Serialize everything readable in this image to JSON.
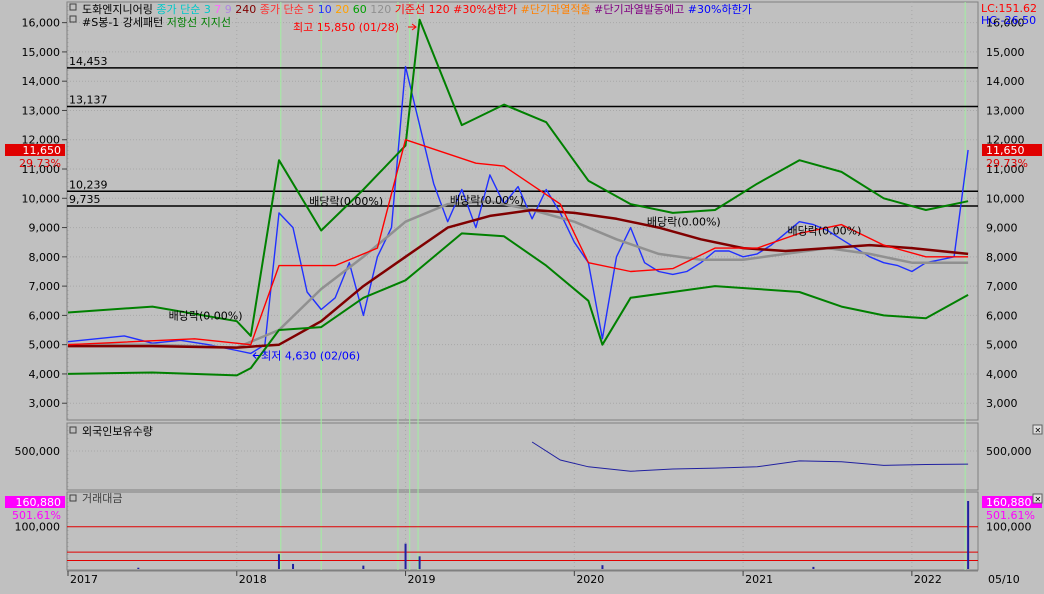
{
  "legend": {
    "row1": [
      {
        "text": "도화엔지니어링",
        "color": "#000000"
      },
      {
        "text": "종가 단순 3",
        "color": "#00c8c8"
      },
      {
        "text": "7",
        "color": "#ff66ff"
      },
      {
        "text": "9",
        "color": "#b088e0"
      },
      {
        "text": "240",
        "color": "#800000"
      },
      {
        "text": "종가 단순 5",
        "color": "#ff3030"
      },
      {
        "text": "10",
        "color": "#2030ff"
      },
      {
        "text": "20",
        "color": "#ffa000"
      },
      {
        "text": "60",
        "color": "#00a000"
      },
      {
        "text": "120",
        "color": "#909090"
      },
      {
        "text": "기준선 120",
        "color": "#ff0000"
      },
      {
        "text": "#30%상한가",
        "color": "#ff0000"
      },
      {
        "text": "#단기과열적출",
        "color": "#ff8000"
      },
      {
        "text": "#단기과열발동예고",
        "color": "#800080"
      },
      {
        "text": "#30%하한가",
        "color": "#0000ff"
      }
    ],
    "row2": [
      {
        "text": "#S봉-1 강세패턴",
        "color": "#000000"
      },
      {
        "text": "저항선",
        "color": "#008000"
      },
      {
        "text": "지지선",
        "color": "#008000"
      }
    ]
  },
  "right_info": {
    "lc": "LC:151.62",
    "hc": "HC:-26.50"
  },
  "chart_data": [
    {
      "type": "line",
      "panel": "price",
      "x_range": [
        "2017-01",
        "2022-05"
      ],
      "ylim": [
        2700,
        16500
      ],
      "y_ticks": [
        3000,
        4000,
        5000,
        6000,
        7000,
        8000,
        9000,
        10000,
        11000,
        12000,
        13000,
        14000,
        15000,
        16000
      ],
      "y_tick_labels": [
        "3,000",
        "4,000",
        "5,000",
        "6,000",
        "7,000",
        "8,000",
        "9,000",
        "10,000",
        "11,000",
        "12,000",
        "13,000",
        "14,000",
        "15,000",
        "16,000"
      ],
      "current_price": {
        "label": "11,650",
        "change": "29.73%",
        "value": 11650
      },
      "horizontal_levels": [
        {
          "value": 14453,
          "label": "14,453"
        },
        {
          "value": 13137,
          "label": "13,137"
        },
        {
          "value": 10239,
          "label": "10,239"
        },
        {
          "value": 9735,
          "label": "9,735"
        }
      ],
      "annotations": [
        {
          "text": "최고 15,850 (01/28)",
          "x": "2019-01-28",
          "y": 15850,
          "color": "#ff0000"
        },
        {
          "text": "최저 4,630 (02/06)",
          "x": "2018-02-06",
          "y": 4630,
          "color": "#0000ff"
        },
        {
          "text": "배당락(0.00%)",
          "x": "2017-11",
          "y": 6000,
          "color": "#000000"
        },
        {
          "text": "배당락(0.00%)",
          "x": "2018-09",
          "y": 9900,
          "color": "#000000"
        },
        {
          "text": "배당락(0.00%)",
          "x": "2019-07",
          "y": 9950,
          "color": "#000000"
        },
        {
          "text": "배당락(0.00%)",
          "x": "2020-09",
          "y": 9200,
          "color": "#000000"
        },
        {
          "text": "배당락(0.00%)",
          "x": "2021-07",
          "y": 8900,
          "color": "#000000"
        }
      ],
      "series": [
        {
          "name": "도화엔지니어링",
          "color": "#2030ff",
          "x": [
            "2017-01",
            "2017-03",
            "2017-05",
            "2017-07",
            "2017-09",
            "2017-11",
            "2018-01",
            "2018-02",
            "2018-03",
            "2018-04",
            "2018-05",
            "2018-06",
            "2018-07",
            "2018-08",
            "2018-09",
            "2018-10",
            "2018-11",
            "2018-12",
            "2019-01",
            "2019-02",
            "2019-03",
            "2019-04",
            "2019-05",
            "2019-06",
            "2019-07",
            "2019-08",
            "2019-09",
            "2019-10",
            "2019-11",
            "2019-12",
            "2020-01",
            "2020-02",
            "2020-03",
            "2020-04",
            "2020-05",
            "2020-06",
            "2020-07",
            "2020-08",
            "2020-09",
            "2020-10",
            "2020-11",
            "2020-12",
            "2021-01",
            "2021-02",
            "2021-03",
            "2021-04",
            "2021-05",
            "2021-06",
            "2021-07",
            "2021-08",
            "2021-09",
            "2021-10",
            "2021-11",
            "2021-12",
            "2022-01",
            "2022-02",
            "2022-03",
            "2022-04",
            "2022-05"
          ],
          "values": [
            5100,
            5200,
            5300,
            5050,
            5150,
            5000,
            4800,
            4700,
            5000,
            9500,
            9000,
            6800,
            6200,
            6600,
            7800,
            6000,
            8000,
            9000,
            14500,
            12500,
            10500,
            9200,
            10300,
            9000,
            10800,
            9800,
            10400,
            9300,
            10300,
            9500,
            8500,
            7800,
            5200,
            8000,
            9000,
            7800,
            7500,
            7400,
            7500,
            7800,
            8200,
            8200,
            8000,
            8100,
            8400,
            8800,
            9200,
            9100,
            8900,
            8600,
            8300,
            8000,
            7800,
            7700,
            7500,
            7800,
            7900,
            8000,
            11650
          ]
        },
        {
          "name": "120",
          "color": "#909090",
          "x": [
            "2017-01",
            "2017-07",
            "2018-01",
            "2018-04",
            "2018-07",
            "2018-10",
            "2019-01",
            "2019-04",
            "2019-07",
            "2019-10",
            "2020-01",
            "2020-04",
            "2020-07",
            "2020-10",
            "2021-01",
            "2021-04",
            "2021-07",
            "2021-10",
            "2022-01",
            "2022-05"
          ],
          "values": [
            5000,
            5000,
            4900,
            5500,
            6900,
            8000,
            9200,
            9800,
            9900,
            9600,
            9200,
            8600,
            8100,
            7900,
            7900,
            8100,
            8300,
            8100,
            7800,
            7800
          ]
        },
        {
          "name": "240",
          "color": "#800000",
          "x": [
            "2017-01",
            "2017-07",
            "2018-01",
            "2018-04",
            "2018-07",
            "2018-10",
            "2019-01",
            "2019-04",
            "2019-07",
            "2019-10",
            "2020-01",
            "2020-04",
            "2020-07",
            "2020-10",
            "2021-01",
            "2021-04",
            "2021-07",
            "2021-10",
            "2022-01",
            "2022-05"
          ],
          "values": [
            4950,
            4950,
            4900,
            5000,
            5800,
            7000,
            8000,
            9000,
            9400,
            9600,
            9500,
            9300,
            9000,
            8600,
            8300,
            8200,
            8300,
            8400,
            8300,
            8100
          ]
        },
        {
          "name": "저항선",
          "color": "#008000",
          "x": [
            "2017-01",
            "2017-07",
            "2018-01",
            "2018-02",
            "2018-04",
            "2018-07",
            "2018-10",
            "2019-01",
            "2019-02",
            "2019-05",
            "2019-08",
            "2019-11",
            "2020-02",
            "2020-05",
            "2020-08",
            "2020-11",
            "2021-02",
            "2021-05",
            "2021-08",
            "2021-11",
            "2022-02",
            "2022-05"
          ],
          "values": [
            6100,
            6300,
            5800,
            5300,
            11300,
            8900,
            10300,
            11800,
            16100,
            12500,
            13200,
            12600,
            10600,
            9800,
            9500,
            9600,
            10500,
            11300,
            10900,
            10000,
            9600,
            9900
          ]
        },
        {
          "name": "지지선",
          "color": "#008000",
          "x": [
            "2017-01",
            "2017-07",
            "2018-01",
            "2018-02",
            "2018-04",
            "2018-07",
            "2018-10",
            "2019-01",
            "2019-02",
            "2019-05",
            "2019-08",
            "2019-11",
            "2020-02",
            "2020-03",
            "2020-05",
            "2020-08",
            "2020-11",
            "2021-02",
            "2021-05",
            "2021-08",
            "2021-11",
            "2022-02",
            "2022-05"
          ],
          "values": [
            4000,
            4050,
            3950,
            4200,
            5500,
            5600,
            6600,
            7200,
            7600,
            8800,
            8700,
            7700,
            6500,
            5000,
            6600,
            6800,
            7000,
            6900,
            6800,
            6300,
            6000,
            5900,
            6700
          ]
        },
        {
          "name": "기준선 120",
          "color": "#ff0000",
          "x": [
            "2017-01",
            "2017-10",
            "2018-02",
            "2018-04",
            "2018-08",
            "2018-11",
            "2019-01",
            "2019-06",
            "2019-08",
            "2019-12",
            "2020-02",
            "2020-05",
            "2020-08",
            "2020-11",
            "2021-02",
            "2021-05",
            "2021-08",
            "2021-11",
            "2022-02",
            "2022-05"
          ],
          "values": [
            5000,
            5200,
            5000,
            7700,
            7700,
            8300,
            12000,
            11200,
            11100,
            9800,
            7800,
            7500,
            7600,
            8300,
            8300,
            8800,
            9100,
            8400,
            8000,
            8000
          ]
        }
      ]
    },
    {
      "type": "line",
      "panel": "foreign_holding",
      "title": "외국인보유수량",
      "y_tick_labels": [
        "500,000"
      ],
      "x_range": [
        "2019-10",
        "2022-05"
      ],
      "series": [
        {
          "name": "외국인보유수량",
          "color": "#2020a0",
          "x": [
            "2019-10",
            "2019-12",
            "2020-02",
            "2020-05",
            "2020-08",
            "2020-11",
            "2021-02",
            "2021-05",
            "2021-08",
            "2021-11",
            "2022-02",
            "2022-05"
          ],
          "values": [
            520000,
            480000,
            465000,
            455000,
            460000,
            462000,
            465000,
            478000,
            476000,
            468000,
            470000,
            471000
          ]
        }
      ]
    },
    {
      "type": "bar",
      "panel": "volume",
      "title": "거래대금",
      "y_tick_labels": [
        "100,000"
      ],
      "current": {
        "label": "160,880",
        "change": "501.61%"
      },
      "ref_lines": [
        {
          "value": 100000,
          "label": "100,000"
        }
      ],
      "series": [
        {
          "name": "거래대금",
          "color": "#2020a0",
          "x": [
            "2017-06",
            "2018-04",
            "2018-05",
            "2018-10",
            "2019-01",
            "2019-02",
            "2020-03",
            "2021-06",
            "2022-05"
          ],
          "values": [
            3000,
            35000,
            12000,
            8000,
            60000,
            30000,
            9000,
            5000,
            160880
          ]
        }
      ]
    }
  ],
  "x_axis": {
    "ticks": [
      "2017",
      "2018",
      "2019",
      "2020",
      "2021",
      "2022"
    ],
    "date_label": "05/10"
  }
}
